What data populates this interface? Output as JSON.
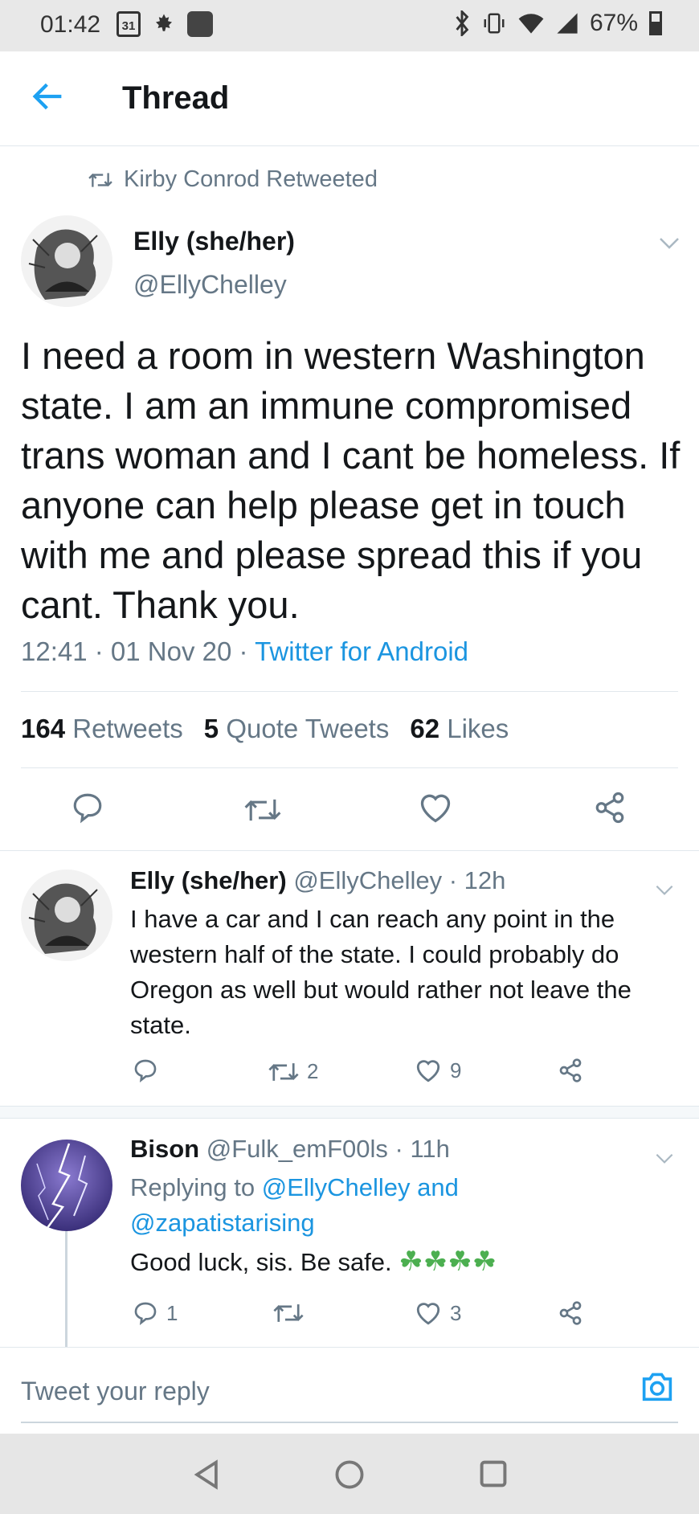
{
  "status_bar": {
    "time": "01:42",
    "calendar_day": "31",
    "battery": "67%"
  },
  "header": {
    "title": "Thread"
  },
  "retweet_banner": {
    "text": "Kirby Conrod Retweeted"
  },
  "main_tweet": {
    "name": "Elly (she/her)",
    "handle": "@EllyChelley",
    "text": "I need a room in western Washington state. I am an immune compromised trans woman and I cant be homeless. If anyone can help please get in touch with me and please spread this if you cant. Thank you.",
    "timestamp": "12:41 · 01 Nov 20 · ",
    "source": "Twitter for Android",
    "retweets_count": "164",
    "retweets_label": "Retweets",
    "quotes_count": "5",
    "quotes_label": "Quote Tweets",
    "likes_count": "62",
    "likes_label": "Likes"
  },
  "replies": [
    {
      "name": "Elly (she/her)",
      "handle": "@EllyChelley · 12h",
      "text": "I have a car and I can reach any point in the western half of the state. I could probably do Oregon as well but would rather not leave the state.",
      "replies": "",
      "retweets": "2",
      "likes": "9"
    },
    {
      "name": "Bison",
      "handle": "@Fulk_emF00ls · 11h",
      "replying_prefix": "Replying to ",
      "replying_to": "@EllyChelley and @zapatistarising",
      "text": "Good luck, sis. Be safe.",
      "emoji": "☘☘☘☘",
      "replies": "1",
      "retweets": "",
      "likes": "3"
    }
  ],
  "composer": {
    "placeholder": "Tweet your reply"
  },
  "colors": {
    "accent": "#1da1f2",
    "muted": "#657786",
    "divider": "#e1e8ed"
  }
}
